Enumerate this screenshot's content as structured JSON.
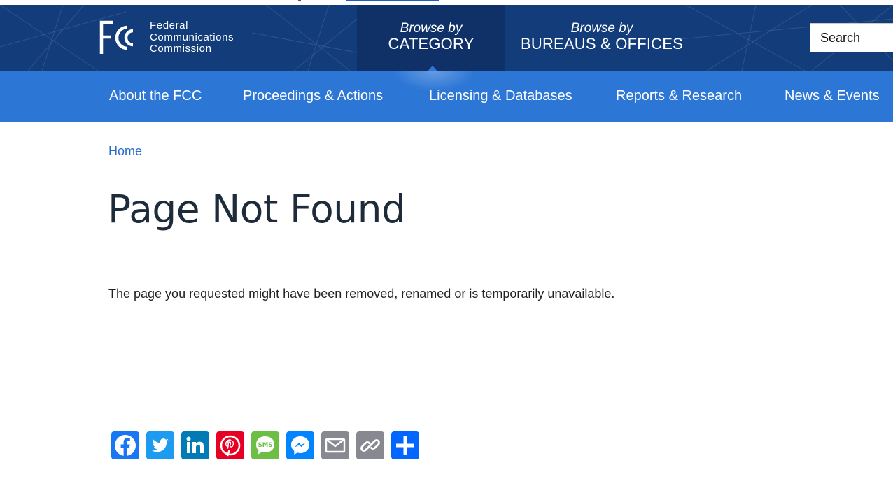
{
  "header": {
    "logo": {
      "text_lines": [
        "Federal",
        "Communications",
        "Commission"
      ]
    },
    "browse_category": {
      "small": "Browse by",
      "big": "CATEGORY"
    },
    "browse_bureaus": {
      "small": "Browse by",
      "big": "BUREAUS & OFFICES"
    },
    "search": {
      "placeholder": "Search"
    }
  },
  "nav": {
    "items": [
      {
        "label": "About the FCC"
      },
      {
        "label": "Proceedings & Actions"
      },
      {
        "label": "Licensing & Databases"
      },
      {
        "label": "Reports & Research"
      },
      {
        "label": "News & Events"
      }
    ]
  },
  "breadcrumb": {
    "home": "Home"
  },
  "page": {
    "title": "Page Not Found",
    "message": "The page you requested might have been removed, renamed or is temporarily unavailable."
  },
  "share": {
    "buttons": [
      {
        "name": "Facebook",
        "icon": "facebook-icon",
        "color": "#1877f2"
      },
      {
        "name": "Twitter",
        "icon": "twitter-icon",
        "color": "#1d9bf0"
      },
      {
        "name": "LinkedIn",
        "icon": "linkedin-icon",
        "color": "#007bb5"
      },
      {
        "name": "Pinterest",
        "icon": "pinterest-icon",
        "color": "#e60023"
      },
      {
        "name": "SMS",
        "icon": "sms-icon",
        "color": "#6cbe45",
        "label": "SMS"
      },
      {
        "name": "Messenger",
        "icon": "messenger-icon",
        "color": "#0084ff"
      },
      {
        "name": "Email",
        "icon": "email-icon",
        "color": "#888990"
      },
      {
        "name": "Copy Link",
        "icon": "copy-link-icon",
        "color": "#888990"
      },
      {
        "name": "Share",
        "icon": "share-icon",
        "color": "#0166ff"
      }
    ]
  },
  "colors": {
    "header_bg": "#123c7a",
    "nav_bg": "#2c76d6",
    "link": "#2a6ac8"
  }
}
